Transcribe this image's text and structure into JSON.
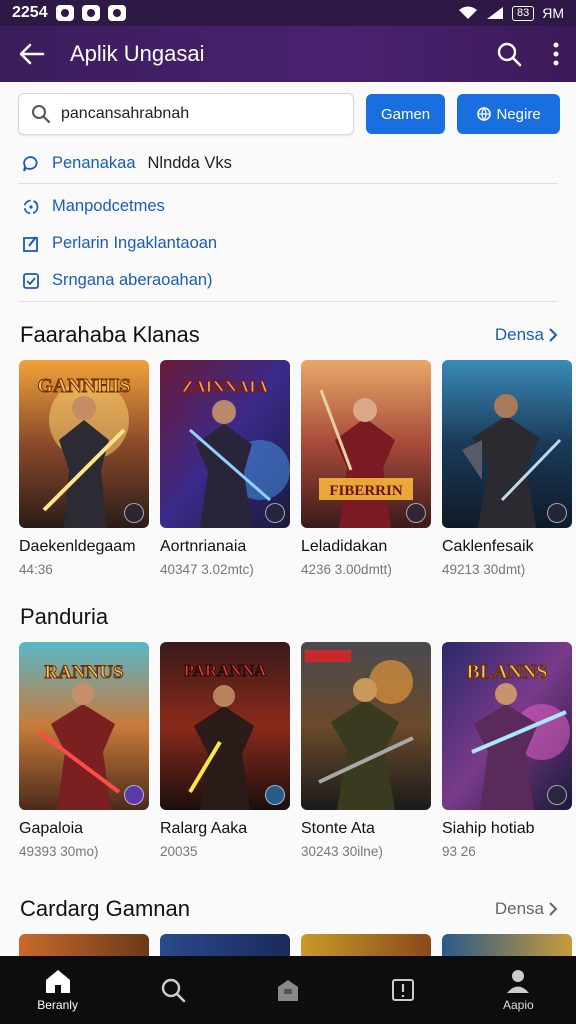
{
  "status": {
    "time": "2254",
    "right_text": "ЯM",
    "battery": "83"
  },
  "app_bar": {
    "title": "Aplik Ungasai"
  },
  "search": {
    "value": "pancansahrabnah",
    "game_button": "Gamen",
    "login_button": "Negire"
  },
  "suggestions": [
    {
      "label_blue": "Penanakaa",
      "label_dark": "Nlndda Vks"
    },
    {
      "label_blue": "Manpodcetmes",
      "label_dark": ""
    },
    {
      "label_blue": "Perlarin Ingaklantaoan",
      "label_dark": ""
    },
    {
      "label_blue": "Srngana aberaoahan)",
      "label_dark": ""
    }
  ],
  "sections": [
    {
      "title": "Faarahaba Klanas",
      "more": "Densa",
      "games": [
        {
          "name": "Daekenldegaam",
          "meta": "44:36",
          "art_title": "GANNHIS"
        },
        {
          "name": "Aortnrianaia",
          "meta": "40347 3.02mtc)",
          "art_title": "ZAINNAIA"
        },
        {
          "name": "Leladidakan",
          "meta": "4236 3.00dmtt)",
          "art_title": "FIBERRIN"
        },
        {
          "name": "Caklenfesaik",
          "meta": "49213 30dmt)",
          "art_title": ""
        }
      ]
    },
    {
      "title": "Panduria",
      "more": "",
      "games": [
        {
          "name": "Gapaloia",
          "meta": "49393 30mo)",
          "art_title": "RANNUS"
        },
        {
          "name": "Ralarg Aaka",
          "meta": "20035",
          "art_title": "PARANNA"
        },
        {
          "name": "Stonte Ata",
          "meta": "30243 30ilne)",
          "art_title": ""
        },
        {
          "name": "Siahip hotiab",
          "meta": "93 26",
          "art_title": "BLANNS"
        }
      ]
    },
    {
      "title": "Cardarg Gamnan",
      "more": "Densa"
    }
  ],
  "bottom_nav": [
    {
      "label": "Beranly",
      "icon": "home-icon"
    },
    {
      "label": "",
      "icon": "search-icon"
    },
    {
      "label": "",
      "icon": "store-icon"
    },
    {
      "label": "",
      "icon": "book-icon"
    },
    {
      "label": "Aapio",
      "icon": "profile-icon"
    }
  ],
  "colors": {
    "header": "#3a1d5c",
    "accent_blue": "#1a6fe0",
    "link_blue": "#1a5db8",
    "bottom_nav": "#0d0d0f"
  }
}
